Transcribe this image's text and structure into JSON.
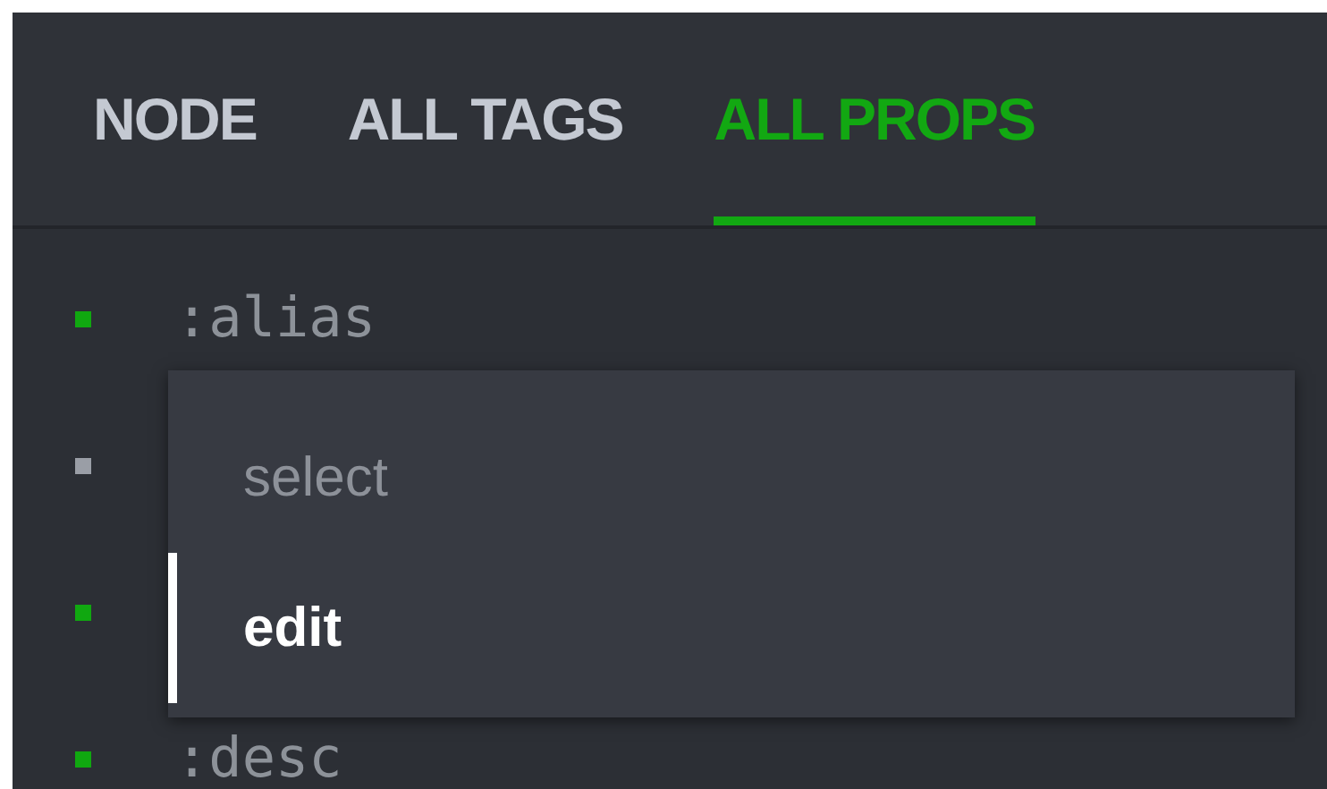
{
  "tabs": [
    {
      "label": "NODE",
      "selected": false
    },
    {
      "label": "ALL TAGS",
      "selected": false
    },
    {
      "label": "ALL PROPS",
      "selected": true
    }
  ],
  "props": [
    {
      "name": ":alias",
      "color": "#10a810"
    },
    {
      "color": "#9a9ea6"
    },
    {
      "color": "#10a810"
    },
    {
      "name": ":desc",
      "color": "#10a810"
    }
  ],
  "menu": [
    {
      "label": "select",
      "selected": false
    },
    {
      "label": "edit",
      "selected": true
    }
  ]
}
